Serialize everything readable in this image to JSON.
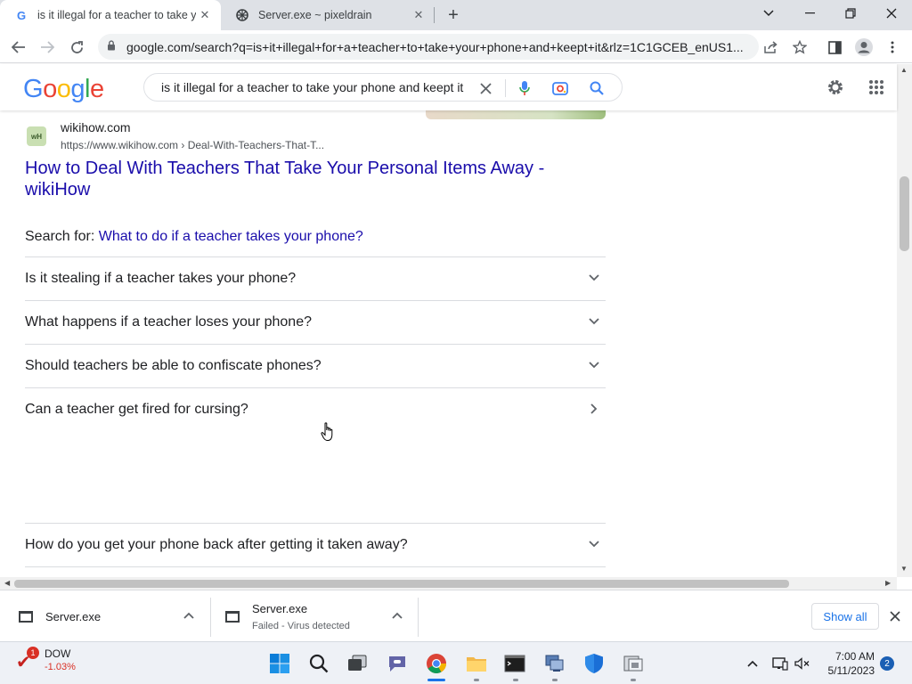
{
  "browser": {
    "tabs": [
      {
        "title": "is it illegal for a teacher to take y",
        "favicon": "google-g-icon",
        "active": true
      },
      {
        "title": "Server.exe ~ pixeldrain",
        "favicon": "pixeldrain-icon",
        "active": false
      }
    ],
    "url": "google.com/search?q=is+it+illegal+for+a+teacher+to+take+your+phone+and+keept+it&rlz=1C1GCEB_enUS1..."
  },
  "google": {
    "logo_letters": [
      "G",
      "o",
      "o",
      "g",
      "l",
      "e"
    ],
    "logo_colors": [
      "#4285F4",
      "#EA4335",
      "#FBBC05",
      "#4285F4",
      "#34A853",
      "#EA4335"
    ],
    "search_value": "is it illegal for a teacher to take your phone and keept it"
  },
  "result": {
    "site_name": "wikihow.com",
    "site_favicon_text": "wH",
    "cite": "https://www.wikihow.com › Deal-With-Teachers-That-T...",
    "title": "How to Deal With Teachers That Take Your Personal Items Away - wikiHow",
    "search_for_label": "Search for:",
    "search_for_query": "What to do if a teacher takes your phone?"
  },
  "paa": [
    {
      "question": "Is it stealing if a teacher takes your phone?",
      "chevron": "chevron-down-icon"
    },
    {
      "question": "What happens if a teacher loses your phone?",
      "chevron": "chevron-down-icon"
    },
    {
      "question": "Should teachers be able to confiscate phones?",
      "chevron": "chevron-down-icon"
    },
    {
      "question": "Can a teacher get fired for cursing?",
      "chevron": "chevron-right-icon"
    },
    {
      "question": "How do you get your phone back after getting it taken away?",
      "chevron": "chevron-down-icon"
    }
  ],
  "downloads": {
    "items": [
      {
        "name": "Server.exe",
        "status": ""
      },
      {
        "name": "Server.exe",
        "status": "Failed - Virus detected"
      }
    ],
    "show_all": "Show all"
  },
  "taskbar": {
    "widget_badge": "1",
    "widget_name": "DOW",
    "widget_change": "-1.03%",
    "time": "7:00 AM",
    "date": "5/11/2023",
    "notification_count": "2"
  },
  "colors": {
    "link": "#1a0dab",
    "accent": "#1a73e8"
  }
}
